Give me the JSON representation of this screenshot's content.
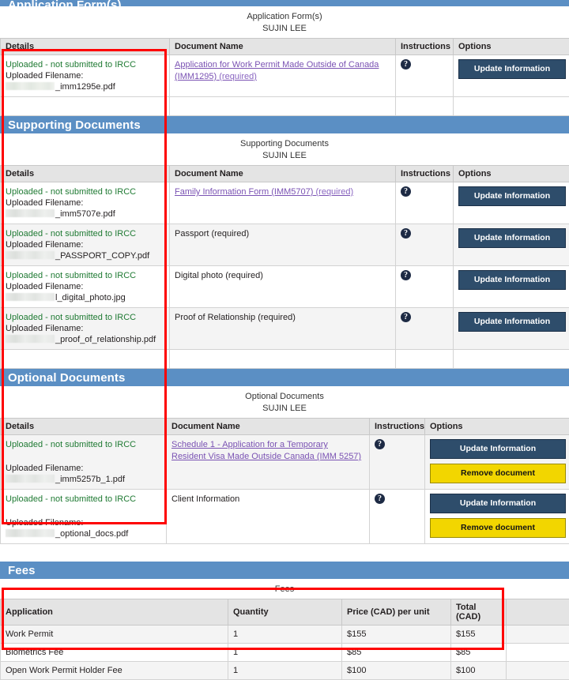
{
  "sections": [
    {
      "id": "application-forms",
      "bar_title": "Application Form(s)",
      "caption_title": "Application Form(s)",
      "caption_name": "SUJIN LEE",
      "columns": [
        "Details",
        "Document Name",
        "Instructions",
        "Options"
      ],
      "rows": [
        {
          "status": "Uploaded - not submitted to IRCC",
          "filename_label": "Uploaded Filename:",
          "filename": "_imm1295e.pdf",
          "doc_name": "Application for Work Permit Made Outside of Canada (IMM1295)",
          "doc_required": "(required)",
          "doc_is_link": true,
          "help_icon": "question-mark-icon",
          "buttons": [
            "Update Information"
          ]
        }
      ]
    },
    {
      "id": "supporting-documents",
      "bar_title": "Supporting Documents",
      "caption_title": "Supporting Documents",
      "caption_name": "SUJIN LEE",
      "columns": [
        "Details",
        "Document Name",
        "Instructions",
        "Options"
      ],
      "rows": [
        {
          "status": "Uploaded - not submitted to IRCC",
          "filename_label": "Uploaded Filename:",
          "filename": "_imm5707e.pdf",
          "doc_name": "Family Information Form (IMM5707)",
          "doc_required": "(required)",
          "doc_is_link": true,
          "help_icon": "question-mark-icon",
          "buttons": [
            "Update Information"
          ]
        },
        {
          "status": "Uploaded - not submitted to IRCC",
          "filename_label": "Uploaded Filename:",
          "filename": "_PASSPORT_COPY.pdf",
          "doc_name": "Passport",
          "doc_required": "(required)",
          "doc_is_link": false,
          "help_icon": "question-mark-icon",
          "buttons": [
            "Update Information"
          ]
        },
        {
          "status": "Uploaded - not submitted to IRCC",
          "filename_label": "Uploaded Filename:",
          "filename": "l_digital_photo.jpg",
          "doc_name": "Digital photo",
          "doc_required": "(required)",
          "doc_is_link": false,
          "help_icon": "question-mark-icon",
          "buttons": [
            "Update Information"
          ]
        },
        {
          "status": "Uploaded - not submitted to IRCC",
          "filename_label": "Uploaded Filename:",
          "filename": "_proof_of_relationship.pdf",
          "doc_name": "Proof of Relationship",
          "doc_required": "(required)",
          "doc_is_link": false,
          "help_icon": "question-mark-icon",
          "buttons": [
            "Update Information"
          ]
        }
      ]
    },
    {
      "id": "optional-documents",
      "bar_title": "Optional Documents",
      "caption_title": "Optional Documents",
      "caption_name": "SUJIN LEE",
      "columns": [
        "Details",
        "Document Name",
        "Instructions",
        "Options"
      ],
      "rows": [
        {
          "status": "Uploaded - not submitted to IRCC",
          "filename_label": "Uploaded Filename:",
          "filename": "_imm5257b_1.pdf",
          "doc_name": "Schedule 1 - Application for a Temporary Resident Visa Made Outside Canada (IMM 5257)",
          "doc_required": "",
          "doc_is_link": true,
          "help_icon": "question-mark-icon",
          "buttons": [
            "Update Information",
            "Remove document"
          ]
        },
        {
          "status": "Uploaded - not submitted to IRCC",
          "filename_label": "Uploaded Filename:",
          "filename": "_optional_docs.pdf",
          "doc_name": "Client Information",
          "doc_required": "",
          "doc_is_link": false,
          "help_icon": "question-mark-icon",
          "buttons": [
            "Update Information",
            "Remove document"
          ]
        }
      ]
    }
  ],
  "fees": {
    "bar_title": "Fees",
    "caption_title": "Fees",
    "columns": [
      "Application",
      "Quantity",
      "Price (CAD) per unit",
      "Total (CAD)"
    ],
    "rows": [
      {
        "application": "Work Permit",
        "quantity": "1",
        "price": "$155",
        "total": "$155"
      },
      {
        "application": "Biometrics Fee",
        "quantity": "1",
        "price": "$85",
        "total": "$85"
      },
      {
        "application": "Open Work Permit Holder Fee",
        "quantity": "1",
        "price": "$100",
        "total": "$100"
      }
    ]
  },
  "colors": {
    "section_bar": "#5b8fc4",
    "update_button": "#2e4d6b",
    "remove_button": "#f2d600",
    "status_green": "#1f7a33",
    "link_purple": "#7a52b3",
    "annotation_red": "#fe0000"
  },
  "annotations": {
    "documents_box": "red-highlight-documents-details-column",
    "fees_box": "red-highlight-fees-table"
  }
}
